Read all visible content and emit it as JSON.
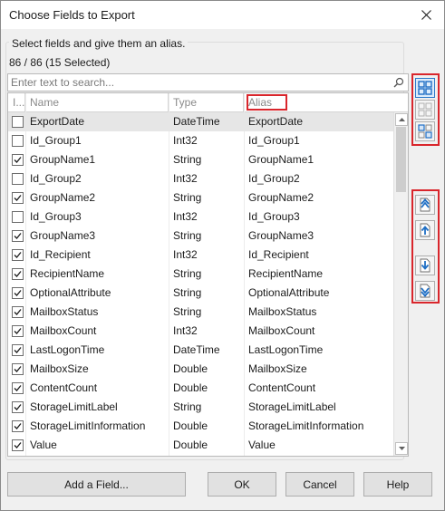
{
  "dialog": {
    "title": "Choose Fields to Export",
    "instruction": "Select fields and give them an alias.",
    "count": "86 / 86 (15 Selected)"
  },
  "search": {
    "placeholder": "Enter text to search..."
  },
  "grid": {
    "columns": {
      "include": "I...",
      "name": "Name",
      "type": "Type",
      "alias": "Alias"
    },
    "rows": [
      {
        "checked": false,
        "name": "ExportDate",
        "type": "DateTime",
        "alias": "ExportDate"
      },
      {
        "checked": false,
        "name": "Id_Group1",
        "type": "Int32",
        "alias": "Id_Group1"
      },
      {
        "checked": true,
        "name": "GroupName1",
        "type": "String",
        "alias": "GroupName1"
      },
      {
        "checked": false,
        "name": "Id_Group2",
        "type": "Int32",
        "alias": "Id_Group2"
      },
      {
        "checked": true,
        "name": "GroupName2",
        "type": "String",
        "alias": "GroupName2"
      },
      {
        "checked": false,
        "name": "Id_Group3",
        "type": "Int32",
        "alias": "Id_Group3"
      },
      {
        "checked": true,
        "name": "GroupName3",
        "type": "String",
        "alias": "GroupName3"
      },
      {
        "checked": true,
        "name": "Id_Recipient",
        "type": "Int32",
        "alias": "Id_Recipient"
      },
      {
        "checked": true,
        "name": "RecipientName",
        "type": "String",
        "alias": "RecipientName"
      },
      {
        "checked": true,
        "name": "OptionalAttribute",
        "type": "String",
        "alias": "OptionalAttribute"
      },
      {
        "checked": true,
        "name": "MailboxStatus",
        "type": "String",
        "alias": "MailboxStatus"
      },
      {
        "checked": true,
        "name": "MailboxCount",
        "type": "Int32",
        "alias": "MailboxCount"
      },
      {
        "checked": true,
        "name": "LastLogonTime",
        "type": "DateTime",
        "alias": "LastLogonTime"
      },
      {
        "checked": true,
        "name": "MailboxSize",
        "type": "Double",
        "alias": "MailboxSize"
      },
      {
        "checked": true,
        "name": "ContentCount",
        "type": "Double",
        "alias": "ContentCount"
      },
      {
        "checked": true,
        "name": "StorageLimitLabel",
        "type": "String",
        "alias": "StorageLimitLabel"
      },
      {
        "checked": true,
        "name": "StorageLimitInformation",
        "type": "Double",
        "alias": "StorageLimitInformation"
      },
      {
        "checked": true,
        "name": "Value",
        "type": "Double",
        "alias": "Value"
      }
    ]
  },
  "side_buttons": {
    "selection": [
      "select-all-icon",
      "select-none-icon",
      "invert-selection-icon"
    ],
    "move": [
      "move-to-top-icon",
      "move-up-icon",
      "move-down-icon",
      "move-to-bottom-icon"
    ]
  },
  "footer": {
    "add_field": "Add a Field...",
    "ok": "OK",
    "cancel": "Cancel",
    "help": "Help"
  },
  "colors": {
    "accent": "#2a79c8",
    "highlight_box": "#d9262c",
    "selected_row": "#e6e6e6"
  }
}
